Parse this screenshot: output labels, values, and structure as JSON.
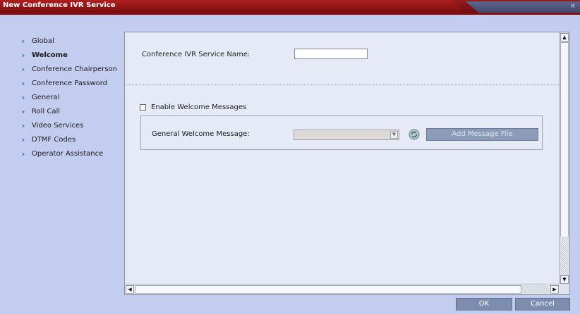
{
  "window": {
    "title": "New Conference IVR Service",
    "close_label": "×"
  },
  "nav": {
    "items": [
      {
        "label": "Global",
        "active": false
      },
      {
        "label": "Welcome",
        "active": true
      },
      {
        "label": "Conference Chairperson",
        "active": false
      },
      {
        "label": "Conference Password",
        "active": false
      },
      {
        "label": "General",
        "active": false
      },
      {
        "label": "Roll Call",
        "active": false
      },
      {
        "label": "Video Services",
        "active": false
      },
      {
        "label": "DTMF Codes",
        "active": false
      },
      {
        "label": "Operator Assistance",
        "active": false
      }
    ],
    "chevron": "›"
  },
  "form": {
    "service_name_label": "Conference IVR Service Name:",
    "service_name_value": "",
    "enable_welcome_label": "Enable Welcome Messages",
    "enable_welcome_checked": false,
    "general_welcome_label": "General Welcome Message:",
    "general_welcome_value": "",
    "add_message_label": "Add Message File"
  },
  "footer": {
    "ok_label": "OK",
    "cancel_label": "Cancel"
  },
  "icons": {
    "refresh": "refresh-icon",
    "chevron": "chevron-right-icon"
  },
  "colors": {
    "title_bar": "#9a1b1b",
    "background": "#c3cdef",
    "panel": "#e6eaf7",
    "chevron": "#1f6fcf",
    "button": "#7c8db0"
  }
}
